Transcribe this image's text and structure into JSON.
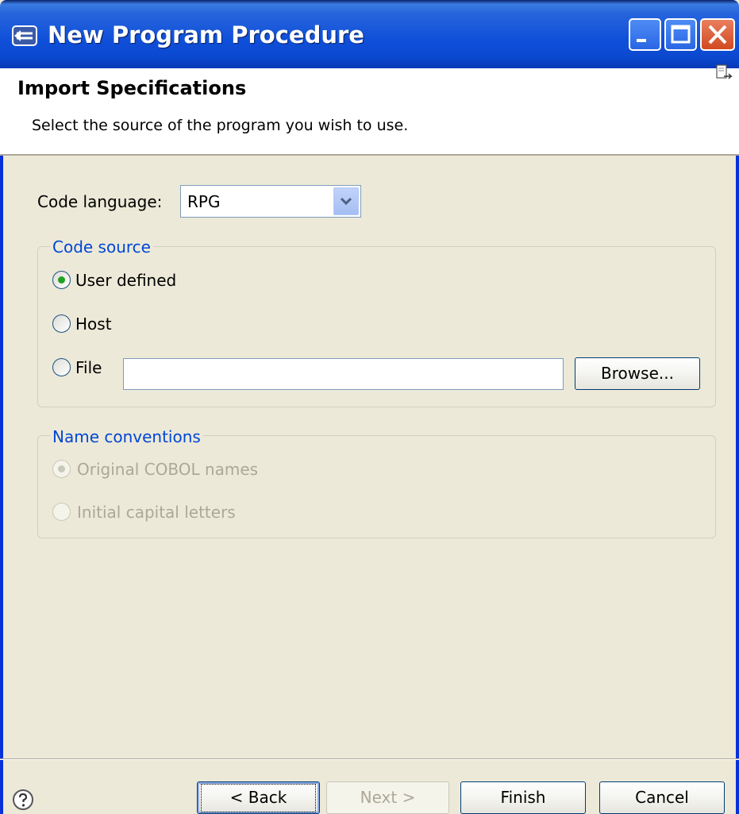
{
  "window": {
    "title": "New Program Procedure"
  },
  "header": {
    "title": "Import Specifications",
    "description": "Select the source of the program you wish to use."
  },
  "code_language": {
    "label": "Code language:",
    "value": "RPG"
  },
  "code_source": {
    "title": "Code source",
    "options": [
      {
        "label": "User defined",
        "selected": true
      },
      {
        "label": "Host",
        "selected": false
      },
      {
        "label": "File",
        "selected": false
      }
    ],
    "file_value": "",
    "browse_label": "Browse..."
  },
  "name_conventions": {
    "title": "Name conventions",
    "options": [
      {
        "label": "Original COBOL names",
        "selected": true,
        "enabled": false
      },
      {
        "label": "Initial capital letters",
        "selected": false,
        "enabled": false
      }
    ]
  },
  "buttons": {
    "back": "< Back",
    "next": "Next >",
    "finish": "Finish",
    "cancel": "Cancel"
  },
  "colors": {
    "titlebar": "#0B48CF",
    "dialog_bg": "#ECE9D8",
    "group_title": "#0046D5",
    "radio_selected": "#21A121"
  }
}
